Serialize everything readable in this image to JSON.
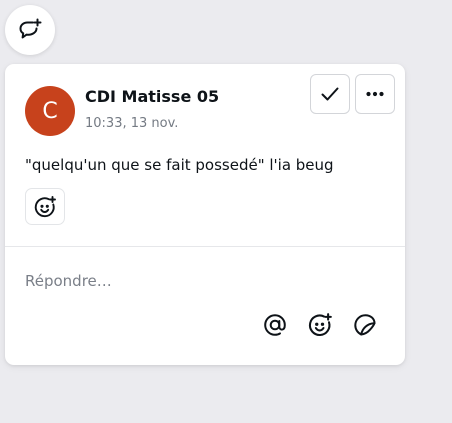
{
  "comment": {
    "author_initial": "C",
    "author_name": "CDI Matisse 05",
    "timestamp": "10:33, 13 nov.",
    "message": "\"quelqu'un que se fait possedé\" l'ia beug",
    "avatar_color": "#c7421c"
  },
  "reply": {
    "placeholder": "Répondre…"
  },
  "icons": {
    "add_comment": "comment-add-icon",
    "resolve": "checkmark-icon",
    "more": "ellipsis-icon",
    "add_reaction": "emoji-add-icon",
    "mention": "at-sign-icon",
    "emoji": "emoji-add-icon",
    "sticker": "sticker-icon"
  }
}
